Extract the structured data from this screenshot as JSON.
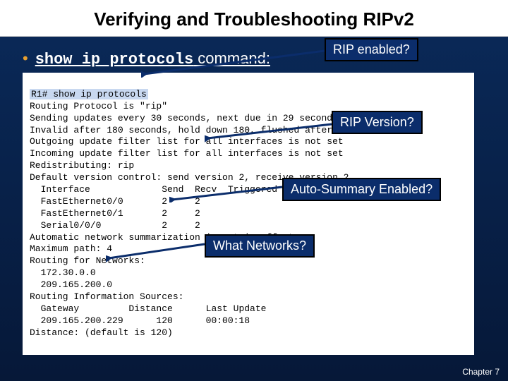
{
  "title": "Verifying and Troubleshooting RIPv2",
  "bullet": {
    "command": "show ip protocols",
    "suffix": " command:"
  },
  "terminal": {
    "prompt": "R1# show ip protocols",
    "lines": [
      "Routing Protocol is \"rip\"",
      "Sending updates every 30 seconds, next due in 29 seconds",
      "Invalid after 180 seconds, hold down 180, flushed after 240",
      "Outgoing update filter list for all interfaces is not set",
      "Incoming update filter list for all interfaces is not set",
      "Redistributing: rip",
      "Default version control: send version 2, receive version 2",
      "  Interface             Send  Recv  Triggered RIP Key-chain",
      "  FastEthernet0/0       2     2",
      "  FastEthernet0/1       2     2",
      "  Serial0/0/0           2     2",
      "Automatic network summarization is not in effect",
      "Maximum path: 4",
      "Routing for Networks:",
      "  172.30.0.0",
      "  209.165.200.0",
      "Routing Information Sources:",
      "  Gateway         Distance      Last Update",
      "  209.165.200.229      120      00:00:18",
      "Distance: (default is 120)"
    ]
  },
  "callouts": {
    "rip_enabled": "RIP enabled?",
    "rip_version": "RIP Version?",
    "auto_summary": "Auto-Summary Enabled?",
    "what_networks": "What Networks?"
  },
  "footer": "Chapter 7"
}
